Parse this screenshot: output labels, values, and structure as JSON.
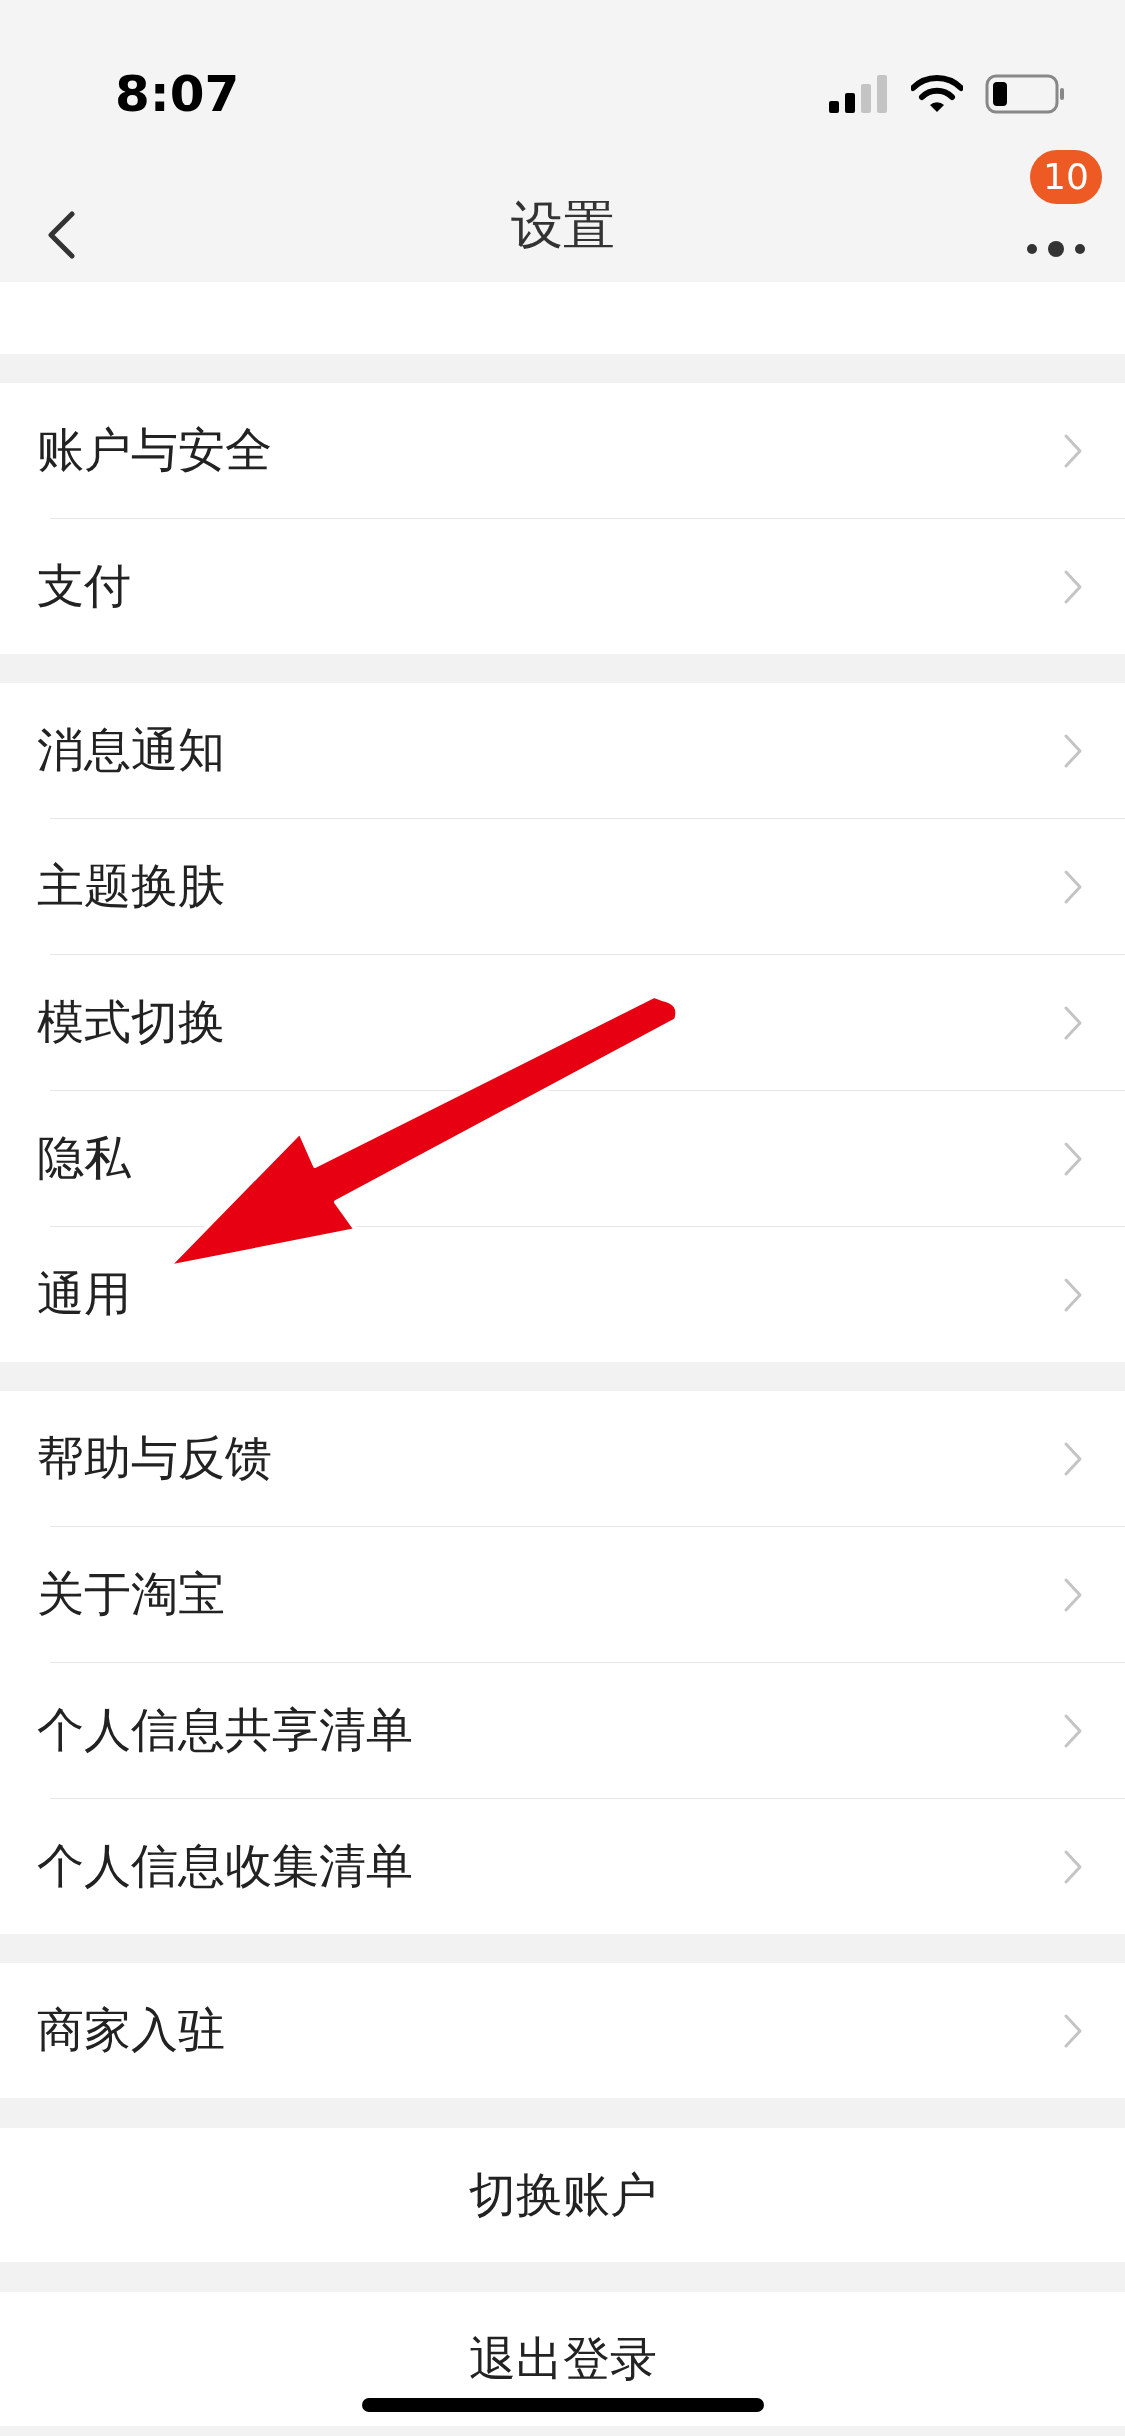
{
  "status_bar": {
    "time": "8:07"
  },
  "nav": {
    "title": "设置",
    "badge": "10"
  },
  "sections": [
    {
      "items": [
        {
          "label": "账户与安全"
        },
        {
          "label": "支付"
        }
      ]
    },
    {
      "items": [
        {
          "label": "消息通知"
        },
        {
          "label": "主题换肤"
        },
        {
          "label": "模式切换"
        },
        {
          "label": "隐私"
        },
        {
          "label": "通用"
        }
      ]
    },
    {
      "items": [
        {
          "label": "帮助与反馈"
        },
        {
          "label": "关于淘宝"
        },
        {
          "label": "个人信息共享清单"
        },
        {
          "label": "个人信息收集清单"
        }
      ]
    },
    {
      "items": [
        {
          "label": "商家入驻"
        }
      ]
    }
  ],
  "buttons": [
    "切换账户",
    "退出登录"
  ]
}
